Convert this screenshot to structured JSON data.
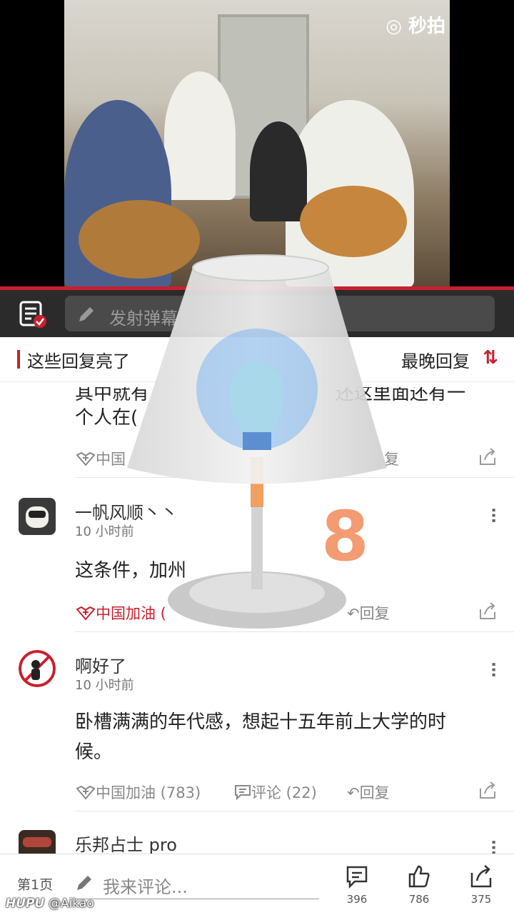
{
  "video": {
    "watermark": "◎ 秒拍"
  },
  "danmaku": {
    "placeholder": "发射弹幕"
  },
  "sort": {
    "title": "这些回复亮了",
    "order": "最晚回复",
    "order_icon": "⇅"
  },
  "comments": [
    {
      "partial_lines": [
        "其中就有",
        "还这里面还有一",
        "个人在("
      ],
      "actions": {
        "like": "中国",
        "reply": "复"
      }
    },
    {
      "username": "一帆风顺丶丶",
      "time": "10 小时前",
      "text": "这条件，加州",
      "actions": {
        "like": "中国加油 (",
        "reply": "回复"
      }
    },
    {
      "username": "啊好了",
      "time": "10 小时前",
      "text_lines": [
        "卧槽满满的年代感，想起十五年前上大学的时",
        "候。"
      ],
      "actions": {
        "like": "中国加油 (783)",
        "comment": "评论 (22)",
        "reply": "回复"
      }
    },
    {
      "username": "乐邦占士 pro"
    }
  ],
  "overlay": {
    "number": "8"
  },
  "bottom": {
    "page": "第1页",
    "placeholder": "我来评论...",
    "stats": [
      {
        "icon": "comment-icon",
        "count": "396"
      },
      {
        "icon": "thumbs-up-icon",
        "count": "786"
      },
      {
        "icon": "share-icon",
        "count": "375"
      }
    ]
  },
  "watermark": {
    "site": "HUPU",
    "author": "@Aikao"
  }
}
